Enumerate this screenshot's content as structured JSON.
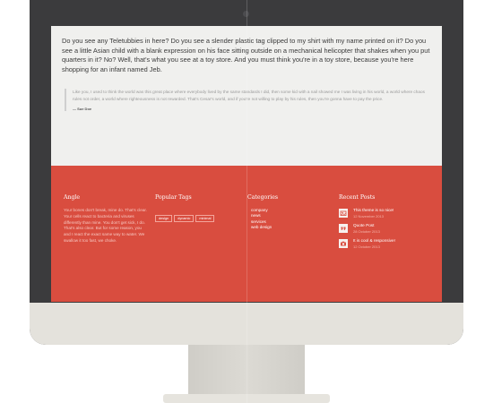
{
  "content": {
    "intro": "Do you see any Teletubbies in here? Do you see a slender plastic tag clipped to my shirt with my name printed on it? Do you see a little Asian child with a blank expression on his face sitting outside on a mechanical helicopter that shakes when you put quarters in it? No? Well, that's what you see at a toy store. And you must think you're in a toy store, because you're here shopping for an infant named Jeb.",
    "quote": "Like you, I used to think the world was this great place where everybody lived by the same standards I did, then some kid with a nail showed me I was living in his world, a world where chaos rules not order, a world where righteousness is not rewarded. That's Cesar's world, and if you're not willing to play by his rules, then you're gonna have to pay the price.",
    "quote_author": "— Sue Doe"
  },
  "footer": {
    "about": {
      "title": "Angle",
      "text": "Your bones don't break, mine do. That's clear. Your cells react to bacteria and viruses differently than mine. You don't get sick, I do. That's also clear. But for some reason, you and I react the exact same way to water. We swallow it too fast, we choke."
    },
    "tags": {
      "title": "Popular Tags",
      "items": [
        "design",
        "dynamic",
        "minimal"
      ]
    },
    "categories": {
      "title": "Categories",
      "items": [
        "company",
        "news",
        "services",
        "web design"
      ]
    },
    "recent_posts": {
      "title": "Recent Posts",
      "items": [
        {
          "icon": "image-icon",
          "title": "This theme is so nice!",
          "date": "12 November 2013"
        },
        {
          "icon": "quote-icon",
          "title": "Quote Post",
          "date": "28 October 2013"
        },
        {
          "icon": "camera-icon",
          "title": "It is cool & responsive!",
          "date": "12 October 2013"
        }
      ]
    }
  },
  "colors": {
    "footer_bg": "#d94d3f",
    "bezel": "#3b3b3d",
    "content_bg": "#f0f0ee"
  }
}
